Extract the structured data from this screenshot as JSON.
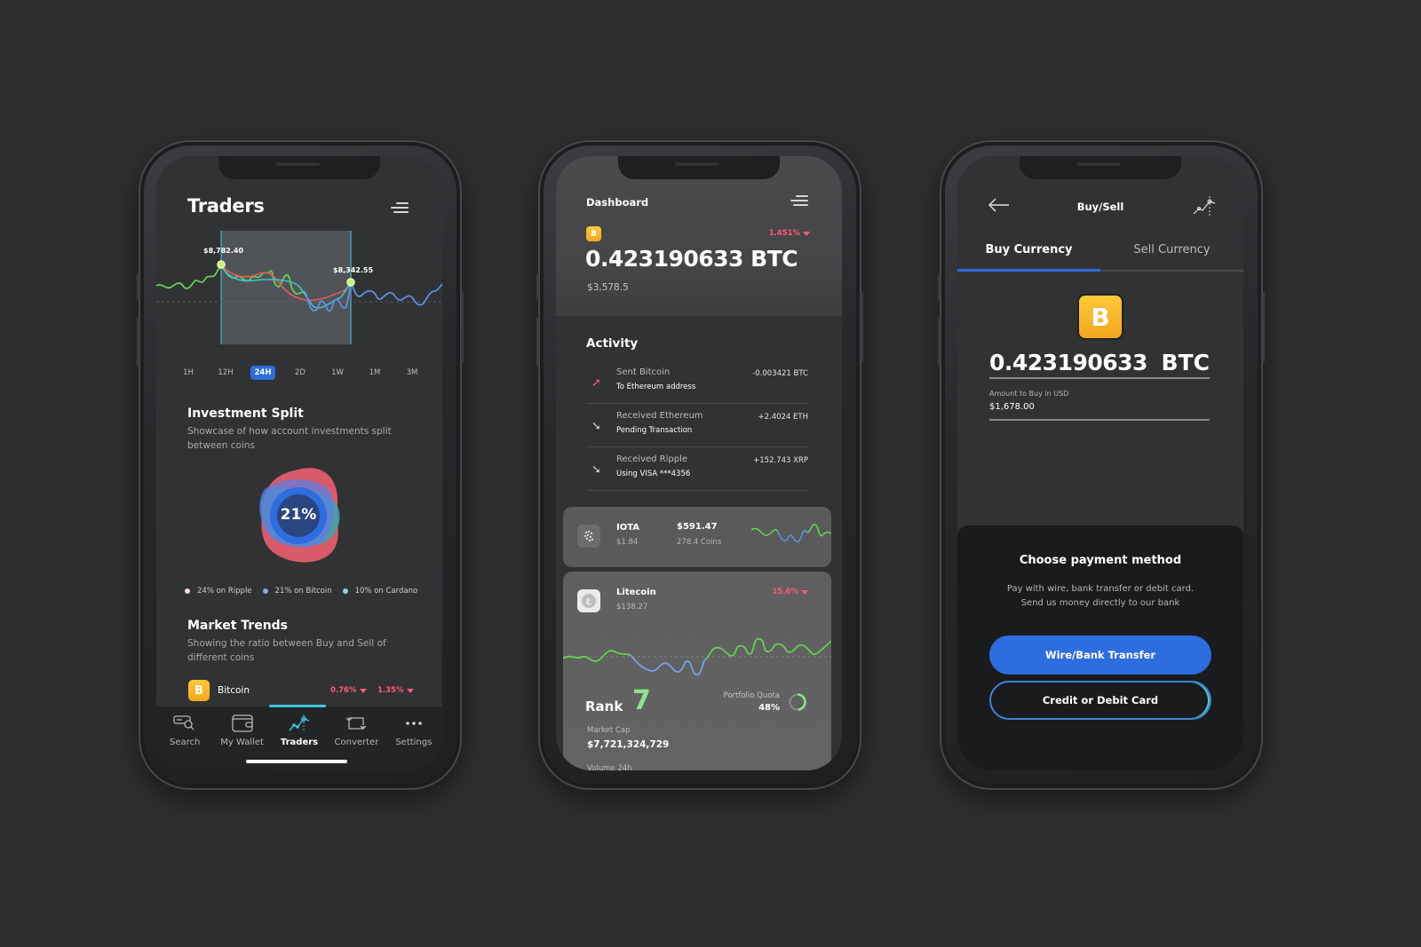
{
  "traders_screen": {
    "title": "Traders",
    "menu_icon": "hamburger-menu-icon",
    "chart": {
      "point_labels": [
        "$8,782.40",
        "$8,342.55"
      ],
      "series_colors": [
        "#62d24f",
        "#e6585f",
        "#5b8fe6",
        "#3fc2cf"
      ]
    },
    "timeframes": [
      {
        "label": "1H",
        "active": false
      },
      {
        "label": "12H",
        "active": false
      },
      {
        "label": "24H",
        "active": true
      },
      {
        "label": "2D",
        "active": false
      },
      {
        "label": "1W",
        "active": false
      },
      {
        "label": "1M",
        "active": false
      },
      {
        "label": "3M",
        "active": false
      }
    ],
    "investment_split": {
      "title": "Investment Split",
      "subtitle": "Showcase of how account investments split between coins",
      "center_value": "21%",
      "legend": [
        {
          "label": "24% on Ripple",
          "color": "#f3dce2"
        },
        {
          "label": "21% on Bitcoin",
          "color": "#8fa7e3"
        },
        {
          "label": "10% on Cardano",
          "color": "#8fd4dc"
        }
      ]
    },
    "market_trends": {
      "title": "Market Trends",
      "subtitle": "Showing the ratio between Buy and Sell of different coins",
      "row": {
        "coin": "Bitcoin",
        "icon_glyph": "B",
        "change_1": "0.76%",
        "change_2": "1.35%"
      }
    },
    "bottom_nav": [
      {
        "label": "Search",
        "icon": "search-card-icon",
        "active": false
      },
      {
        "label": "My Wallet",
        "icon": "wallet-icon",
        "active": false
      },
      {
        "label": "Traders",
        "icon": "chart-line-icon",
        "active": true
      },
      {
        "label": "Converter",
        "icon": "convert-arrows-icon",
        "active": false
      },
      {
        "label": "Settings",
        "icon": "more-dots-icon",
        "active": false
      }
    ]
  },
  "dashboard_screen": {
    "title": "Dashboard",
    "balance": {
      "icon_glyph": "B",
      "change": "1.451%",
      "amount": "0.423190633 BTC",
      "usd": "$3,578.5"
    },
    "activity": {
      "title": "Activity",
      "items": [
        {
          "title": "Sent Bitcoin",
          "subtitle": "To Ethereum address",
          "value": "-0.003421 BTC",
          "direction": "sent"
        },
        {
          "title": "Received Ethereum",
          "subtitle": "Pending Transaction",
          "value": "+2.4024 ETH",
          "direction": "received"
        },
        {
          "title": "Received Ripple",
          "subtitle": "Using VISA ***4356",
          "value": "+152.743 XRP",
          "direction": "received"
        }
      ]
    },
    "iota_card": {
      "name": "IOTA",
      "price": "$1.84",
      "value": "$591.47",
      "coins": "278.4 Coins"
    },
    "litecoin_card": {
      "name": "Litecoin",
      "price": "$138.27",
      "change": "15.6%",
      "rank_label": "Rank",
      "rank_value": "7",
      "portfolio_quota_label": "Portfolio Quota",
      "portfolio_quota_value": "48%",
      "portfolio_quota_fraction": 0.48,
      "market_cap_label": "Market Cap",
      "market_cap_value": "$7,721,324,729",
      "volume_label": "Volume 24h"
    }
  },
  "buysell_screen": {
    "title": "Buy/Sell",
    "tabs": [
      {
        "label": "Buy Currency",
        "active": true
      },
      {
        "label": "Sell Currency",
        "active": false
      }
    ],
    "coin_glyph": "B",
    "amount": "0.423190633",
    "currency": "BTC",
    "usd_label": "Amount to Buy in USD",
    "usd_value": "$1,678.00",
    "payment": {
      "title": "Choose payment method",
      "subtitle_line1": "Pay with wire, bank transfer or debit card.",
      "subtitle_line2": "Send us money directly to our bank",
      "primary_button": "Wire/Bank Transfer",
      "secondary_button": "Credit or Debit Card"
    }
  },
  "colors": {
    "accent_blue": "#2e6ddf",
    "negative": "#ff5b78",
    "positive": "#8fe28a",
    "bitcoin": "#f7b42c",
    "teal": "#3cc7e6"
  }
}
